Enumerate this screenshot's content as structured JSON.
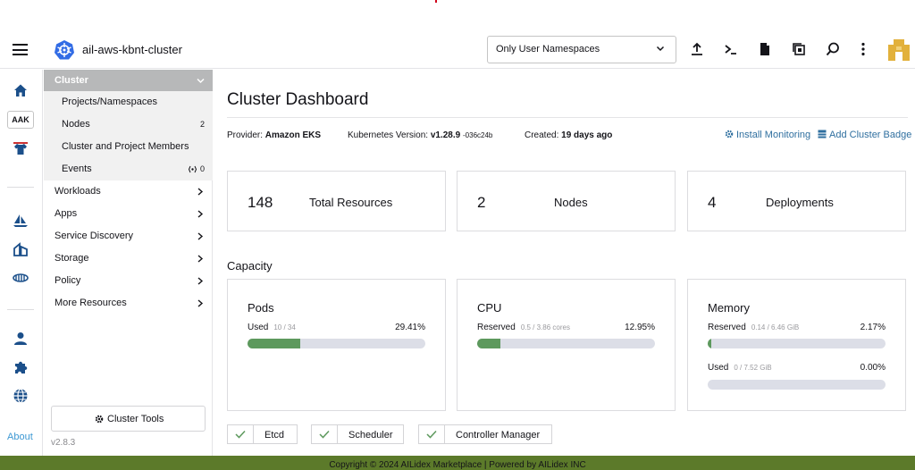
{
  "header": {
    "cluster_name": "ail-aws-kbnt-cluster",
    "namespace_filter": "Only User Namespaces"
  },
  "rail": {
    "badge": "AAK",
    "about": "About"
  },
  "sidebar": {
    "section_label": "Cluster",
    "sub_items": [
      {
        "label": "Projects/Namespaces",
        "count": ""
      },
      {
        "label": "Nodes",
        "count": "2"
      },
      {
        "label": "Cluster and Project Members",
        "count": ""
      },
      {
        "label": "Events",
        "count": "0"
      }
    ],
    "items": [
      {
        "label": "Workloads"
      },
      {
        "label": "Apps"
      },
      {
        "label": "Service Discovery"
      },
      {
        "label": "Storage"
      },
      {
        "label": "Policy"
      },
      {
        "label": "More Resources"
      }
    ],
    "cluster_tools": "Cluster Tools",
    "version": "v2.8.3"
  },
  "main": {
    "title": "Cluster Dashboard",
    "provider_label": "Provider:",
    "provider_value": "Amazon EKS",
    "k8s_label": "Kubernetes Version:",
    "k8s_value": "v1.28.9",
    "k8s_suffix": "-036c24b",
    "created_label": "Created:",
    "created_value": "19 days ago",
    "install_monitoring": "Install Monitoring",
    "add_badge": "Add Cluster Badge",
    "summary": [
      {
        "value": "148",
        "label": "Total Resources"
      },
      {
        "value": "2",
        "label": "Nodes"
      },
      {
        "value": "4",
        "label": "Deployments"
      }
    ],
    "capacity_title": "Capacity",
    "capacity": {
      "pods": {
        "title": "Pods",
        "row_label": "Used",
        "detail": "10 / 34",
        "percent": "29.41%",
        "fraction": 0.2941
      },
      "cpu": {
        "title": "CPU",
        "row_label": "Reserved",
        "detail": "0.5 / 3.86 cores",
        "percent": "12.95%",
        "fraction": 0.1295
      },
      "memory": {
        "title": "Memory",
        "reserved": {
          "row_label": "Reserved",
          "detail": "0.14 / 6.46 GiB",
          "percent": "2.17%",
          "fraction": 0.0217
        },
        "used": {
          "row_label": "Used",
          "detail": "0 / 7.52 GiB",
          "percent": "0.00%",
          "fraction": 0.0
        }
      }
    },
    "components": [
      "Etcd",
      "Scheduler",
      "Controller Manager"
    ]
  },
  "footer": {
    "text": "Copyright © 2024 AILidex Marketplace | Powered by AILidex INC"
  },
  "colors": {
    "bar_fill": "#5d995d",
    "bar_track": "#dcdee7",
    "footer_bg": "#5c7a2a",
    "link": "#2f6f9f",
    "sidebar_header": "#b7b8b9",
    "rail_icons": "#1b4f8a"
  }
}
